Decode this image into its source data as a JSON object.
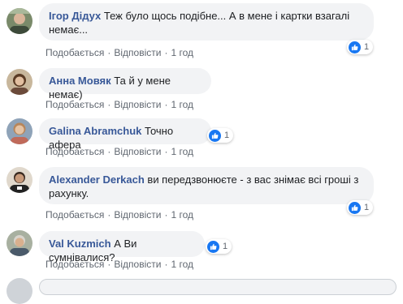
{
  "comments": [
    {
      "author": "Ігор Дідух",
      "text_line1": "Теж було щось подібне... А в мене і картки взагалі",
      "text_line2": "немає...",
      "like_label": "Подобається",
      "reply_label": "Відповісти",
      "time": "1 год",
      "reaction_count": "1"
    },
    {
      "author": "Анна Мовяк",
      "text_line1": "Та й у мене немає)",
      "like_label": "Подобається",
      "reply_label": "Відповісти",
      "time": "1 год"
    },
    {
      "author": "Galina Abramchuk",
      "text_line1": "Точно афера",
      "like_label": "Подобається",
      "reply_label": "Відповісти",
      "time": "1 год",
      "reaction_count": "1"
    },
    {
      "author": "Alexander Derkach",
      "text_line1": "ви передзвонюєте - з вас знімає всі гроші з",
      "text_line2": "рахунку.",
      "like_label": "Подобається",
      "reply_label": "Відповісти",
      "time": "1 год",
      "reaction_count": "1"
    },
    {
      "author": "Val Kuzmich",
      "text_line1": "А Ви сумнівалися?",
      "like_label": "Подобається",
      "reply_label": "Відповісти",
      "time": "1 год",
      "reaction_count": "1"
    }
  ],
  "icons": {
    "reaction": "like-thumb-icon",
    "reaction_color": "#1877f2"
  },
  "colors": {
    "author": "#385898",
    "bubble": "#f2f3f5",
    "meta": "#606770"
  }
}
